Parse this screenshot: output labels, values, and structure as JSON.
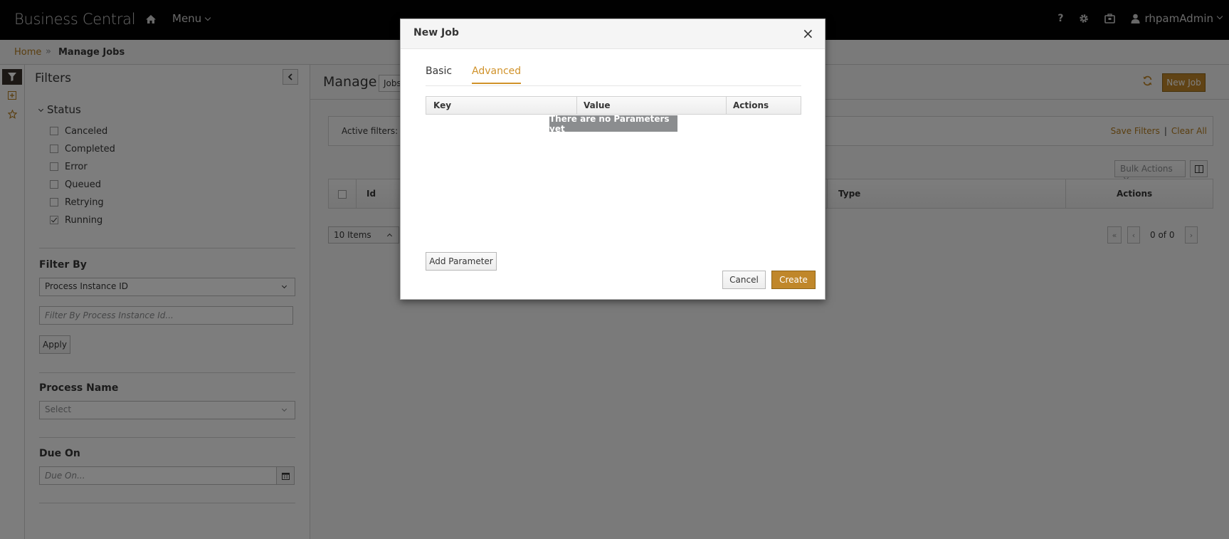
{
  "header": {
    "brand": "Business Central",
    "menu_label": "Menu",
    "help_label": "?",
    "user_label": "rhpamAdmin"
  },
  "breadcrumb": {
    "home": "Home",
    "separator": "»",
    "current": "Manage Jobs"
  },
  "filters": {
    "title": "Filters",
    "status_title": "Status",
    "status_items": [
      {
        "label": "Canceled",
        "checked": false
      },
      {
        "label": "Completed",
        "checked": false
      },
      {
        "label": "Error",
        "checked": false
      },
      {
        "label": "Queued",
        "checked": false
      },
      {
        "label": "Retrying",
        "checked": false
      },
      {
        "label": "Running",
        "checked": true
      }
    ],
    "filter_by_label": "Filter By",
    "filter_by_value": "Process Instance ID",
    "filter_by_placeholder": "Filter By Process Instance Id...",
    "apply_label": "Apply",
    "process_name_label": "Process Name",
    "process_name_value": "Select",
    "due_on_label": "Due On",
    "due_on_placeholder": "Due On..."
  },
  "main": {
    "title": "Manage",
    "jobs_select": "Jobs",
    "new_job_label": "New Job",
    "active_filters_label": "Active filters:",
    "save_filters_label": "Save Filters",
    "link_separator": "|",
    "clear_all_label": "Clear All",
    "bulk_actions_label": "Bulk Actions",
    "columns": {
      "id": "Id",
      "type": "Type",
      "actions": "Actions"
    },
    "items_per_page": "10 Items",
    "pager_text": "0 of 0"
  },
  "modal": {
    "title": "New Job",
    "close_glyph": "×",
    "tabs": [
      {
        "label": "Basic",
        "active": false
      },
      {
        "label": "Advanced",
        "active": true
      }
    ],
    "params_columns": {
      "key": "Key",
      "value": "Value",
      "actions": "Actions"
    },
    "empty_message": "There are no Parameters yet",
    "add_parameter_label": "Add Parameter",
    "cancel_label": "Cancel",
    "create_label": "Create"
  },
  "colors": {
    "accent": "#c0872a",
    "link": "#b57c1e",
    "topbar": "#030303"
  }
}
